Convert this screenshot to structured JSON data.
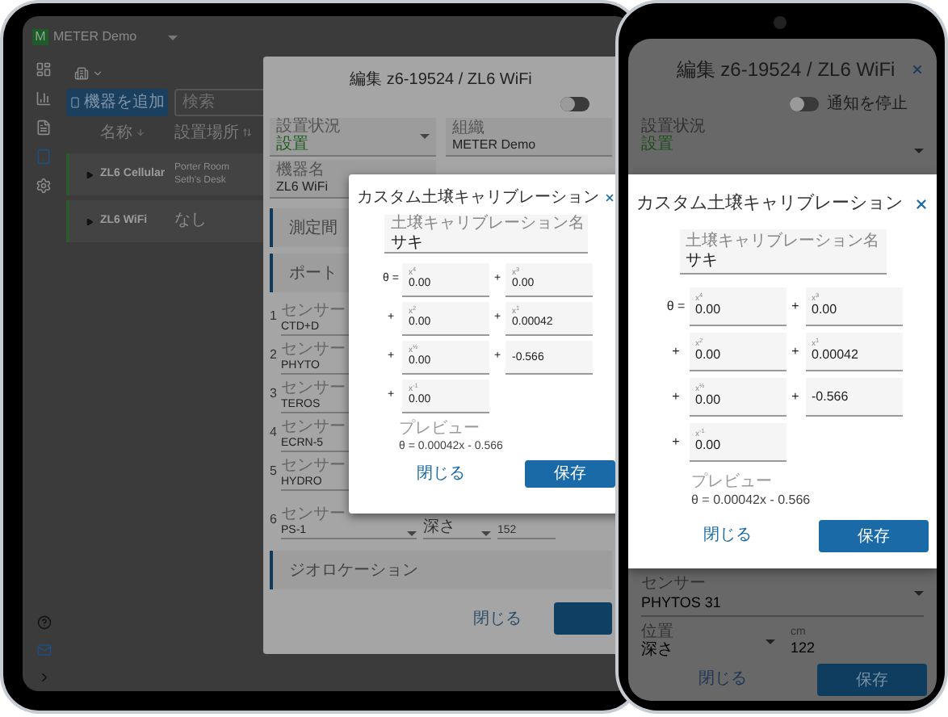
{
  "tablet": {
    "app_bar": {
      "logo": "M",
      "org": "METER Demo"
    },
    "sidebar": {
      "items": [
        {
          "kind": "dashboard",
          "selected": false
        },
        {
          "kind": "chart",
          "selected": false
        },
        {
          "kind": "report",
          "selected": false
        },
        {
          "kind": "device",
          "selected": true
        },
        {
          "kind": "settings",
          "selected": false
        }
      ],
      "footer": [
        {
          "kind": "help"
        },
        {
          "kind": "mail"
        },
        {
          "kind": "expand"
        }
      ]
    },
    "toolbar": {
      "add_button": "機器を追加",
      "search": {
        "placeholder": "検索"
      }
    },
    "table": {
      "columns": [
        "名称",
        "設置場所"
      ],
      "rows": [
        {
          "name": "ZL6 Cellular",
          "location": [
            "Porter Room",
            "Seth's Desk"
          ]
        },
        {
          "name": "ZL6 WiFi",
          "location": [
            "なし"
          ]
        }
      ]
    },
    "edit_dialog": {
      "title": "編集 z6-19524 / ZL6 WiFi",
      "notifications_toggle": {
        "on": false
      },
      "fields": [
        {
          "label": "設置状況",
          "value": "設置",
          "kind": "select"
        },
        {
          "label": "組織",
          "value": "METER Demo",
          "kind": "text"
        },
        {
          "label": "機器名",
          "value": "ZL6 WiFi",
          "kind": "text"
        }
      ],
      "sections": [
        "測定間",
        "ポート"
      ],
      "ports": [
        {
          "number": "1",
          "label": "センサー",
          "value": "CTD+D"
        },
        {
          "number": "2",
          "label": "センサー",
          "value": "PHYTO"
        },
        {
          "number": "3",
          "label": "センサー",
          "value": "TEROS"
        },
        {
          "number": "4",
          "label": "センサー",
          "value": "ECRN-5"
        },
        {
          "number": "5",
          "label": "センサー",
          "value": "HYDRO"
        },
        {
          "number": "6",
          "label": "センサー",
          "value": "PS-1",
          "position": "深さ",
          "depth": "152"
        }
      ],
      "geolocation": "ジオロケーション",
      "close_button": "閉じる"
    },
    "calibration_dialog": {
      "title": "カスタム土壌キャリブレーション",
      "name_field": {
        "label": "土壌キャリブレーション名",
        "value": "サキ"
      },
      "coefficients": [
        {
          "lead": "θ =",
          "label": "x$^{4}$",
          "value": "0.00"
        },
        {
          "lead": "+",
          "label": "x$^{3}$",
          "value": "0.00"
        },
        {
          "lead": "+",
          "label": "x$^{2}$",
          "value": "0.00"
        },
        {
          "lead": "+",
          "label": "x$^{1}$",
          "value": "0.00042"
        },
        {
          "lead": "+",
          "label": "x$^{½}$",
          "value": "0.00"
        },
        {
          "lead": "+",
          "value": "-0.566"
        },
        {
          "lead": "+",
          "label": "x$^{-1}$",
          "value": "0.00"
        }
      ],
      "preview_label": "プレビュー",
      "preview": "θ = 0.00042x - 0.566",
      "close_button": "閉じる",
      "save_button": "保存"
    }
  },
  "phone": {
    "edit_dialog": {
      "title": "編集 z6-19524 / ZL6 WiFi",
      "notifications_toggle": {
        "on": false,
        "label": "通知を停止"
      },
      "status_field": {
        "label": "設置状況",
        "value": "設置"
      }
    },
    "calibration_dialog": {
      "title": "カスタム土壌キャリブレーション",
      "name_field": {
        "label": "土壌キャリブレーション名",
        "value": "サキ"
      },
      "coefficients": [
        {
          "lead": "θ =",
          "label": "x$^{4}$",
          "value": "0.00"
        },
        {
          "lead": "+",
          "label": "x$^{3}$",
          "value": "0.00"
        },
        {
          "lead": "+",
          "label": "x$^{2}$",
          "value": "0.00"
        },
        {
          "lead": "+",
          "label": "x$^{1}$",
          "value": "0.00042"
        },
        {
          "lead": "+",
          "label": "x$^{½}$",
          "value": "0.00"
        },
        {
          "lead": "+",
          "value": "-0.566"
        },
        {
          "lead": "+",
          "label": "x$^{-1}$",
          "value": "0.00"
        }
      ],
      "preview_label": "プレビュー",
      "preview": "θ = 0.00042x - 0.566",
      "close_button": "閉じる",
      "save_button": "保存"
    },
    "port": {
      "sensor": {
        "label": "センサー",
        "value": "PHYTOS 31"
      },
      "position": {
        "label": "位置",
        "value": "深さ"
      },
      "depth": {
        "label": "cm",
        "value": "122"
      }
    },
    "footer": {
      "close_button": "閉じる",
      "save_button": "保存"
    }
  }
}
